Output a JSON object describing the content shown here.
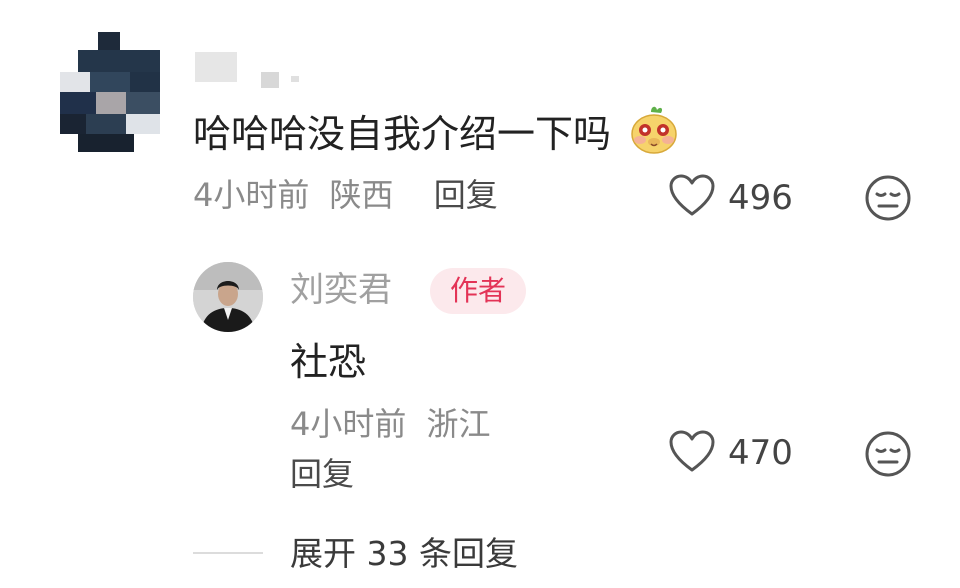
{
  "top_comment": {
    "username": "",
    "text": "哈哈哈没自我介绍一下吗",
    "emoji_icon": "cute-pig-face-emoji",
    "time": "4小时前",
    "location": "陕西",
    "reply_label": "回复",
    "likes": "496"
  },
  "reply": {
    "username": "刘奕君",
    "badge": "作者",
    "text": "社恐",
    "time": "4小时前",
    "location": "浙江",
    "reply_label": "回复",
    "likes": "470"
  },
  "expand": {
    "label": "展开 33 条回复"
  },
  "colors": {
    "badge_bg": "#fce9ec",
    "badge_text": "#e33356",
    "meta_text": "#8a8a8a",
    "body_text": "#222222"
  },
  "icons": {
    "like": "heart-outline-icon",
    "dislike": "neutral-face-icon"
  }
}
